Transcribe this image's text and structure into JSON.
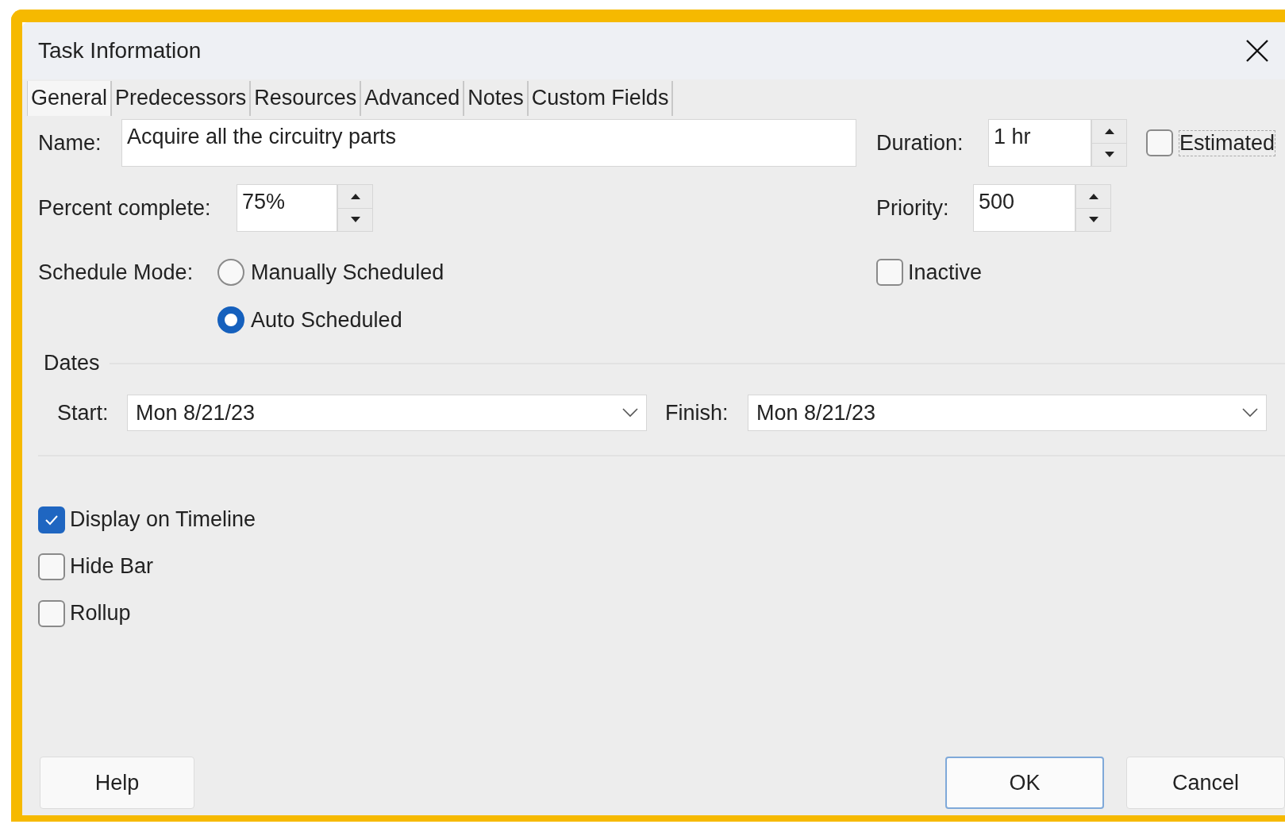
{
  "window": {
    "title": "Task Information"
  },
  "tabs": [
    {
      "label": "General",
      "selected": true
    },
    {
      "label": "Predecessors",
      "selected": false
    },
    {
      "label": "Resources",
      "selected": false
    },
    {
      "label": "Advanced",
      "selected": false
    },
    {
      "label": "Notes",
      "selected": false
    },
    {
      "label": "Custom Fields",
      "selected": false
    }
  ],
  "name": {
    "label": "Name:",
    "value": "Acquire all the circuitry parts"
  },
  "duration": {
    "label": "Duration:",
    "value": "1 hr"
  },
  "estimated": {
    "label": "Estimated",
    "checked": false
  },
  "percent_complete": {
    "label": "Percent complete:",
    "value": "75%"
  },
  "priority": {
    "label": "Priority:",
    "value": "500"
  },
  "schedule_mode": {
    "label": "Schedule Mode:",
    "options": [
      {
        "label": "Manually Scheduled",
        "selected": false
      },
      {
        "label": "Auto Scheduled",
        "selected": true
      }
    ]
  },
  "inactive": {
    "label": "Inactive",
    "checked": false
  },
  "dates": {
    "title": "Dates",
    "start": {
      "label": "Start:",
      "value": "Mon 8/21/23"
    },
    "finish": {
      "label": "Finish:",
      "value": "Mon 8/21/23"
    }
  },
  "options": [
    {
      "label": "Display on Timeline",
      "checked": true
    },
    {
      "label": "Hide Bar",
      "checked": false
    },
    {
      "label": "Rollup",
      "checked": false
    }
  ],
  "buttons": [
    {
      "label": "Help",
      "default": false
    },
    {
      "label": "OK",
      "default": true
    },
    {
      "label": "Cancel",
      "default": false
    }
  ]
}
